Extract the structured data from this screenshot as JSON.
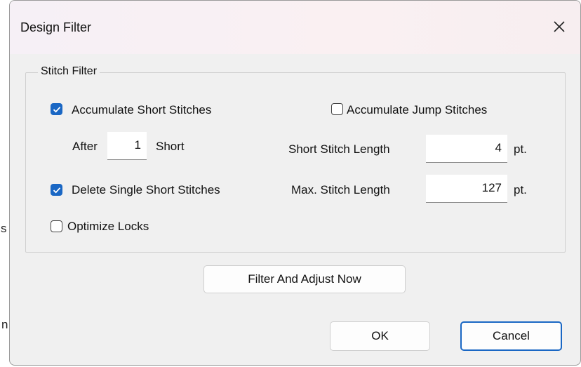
{
  "window": {
    "title": "Design Filter"
  },
  "background": {
    "fragment_1": "s",
    "fragment_2": "n"
  },
  "group": {
    "label": "Stitch Filter"
  },
  "options": {
    "accumulate_short": {
      "label": "Accumulate Short Stitches",
      "checked": true
    },
    "accumulate_jump": {
      "label": "Accumulate Jump Stitches",
      "checked": false
    },
    "delete_single_short": {
      "label": "Delete Single Short Stitches",
      "checked": true
    },
    "optimize_locks": {
      "label": "Optimize Locks",
      "checked": false
    }
  },
  "after": {
    "prefix": "After",
    "value": "1",
    "suffix": "Short"
  },
  "short_stitch_length": {
    "label": "Short Stitch Length",
    "value": "4",
    "unit": "pt."
  },
  "max_stitch_length": {
    "label": "Max. Stitch Length",
    "value": "127",
    "unit": "pt."
  },
  "buttons": {
    "filter_adjust": "Filter And Adjust Now",
    "ok": "OK",
    "cancel": "Cancel"
  },
  "colors": {
    "accent": "#1a67c4",
    "dialog_bg": "#f0f0f0"
  }
}
